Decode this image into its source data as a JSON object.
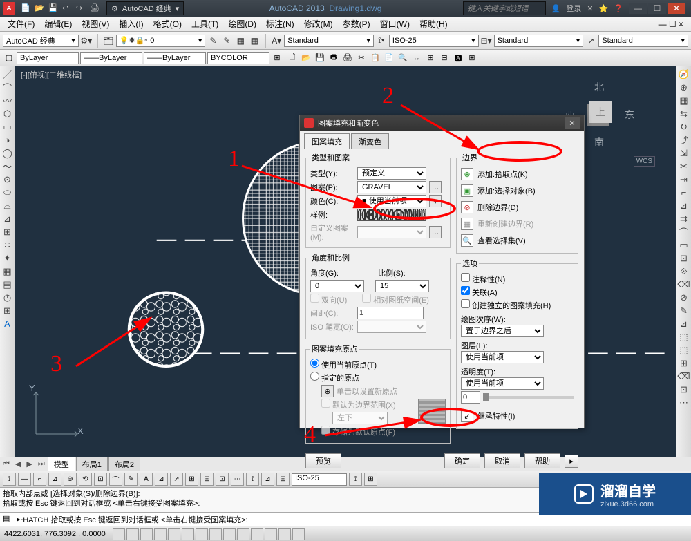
{
  "titlebar": {
    "workspace": "AutoCAD 经典",
    "app": "AutoCAD 2013",
    "file": "Drawing1.dwg",
    "search_ph": "键入关键字或短语",
    "login": "登录"
  },
  "menubar": {
    "file": "文件(F)",
    "edit": "编辑(E)",
    "view": "视图(V)",
    "insert": "插入(I)",
    "format": "格式(O)",
    "tools": "工具(T)",
    "draw": "绘图(D)",
    "dimension": "标注(N)",
    "modify": "修改(M)",
    "parametric": "参数(P)",
    "window": "窗口(W)",
    "help": "帮助(H)"
  },
  "toolbar1": {
    "workspace": "AutoCAD 经典",
    "layer": "0",
    "textstyle": "Standard",
    "dimstyle": "ISO-25",
    "tablestyle": "Standard",
    "mlstyle": "Standard"
  },
  "toolbar2": {
    "bylayer": "ByLayer",
    "bycolor": "BYCOLOR"
  },
  "canvas": {
    "viewlabel": "[-][俯视][二维线框]",
    "north": "北",
    "south": "南",
    "east": "东",
    "west": "西",
    "top": "上",
    "wcs": "WCS",
    "ucs_x": "X",
    "ucs_y": "Y"
  },
  "dialog": {
    "title": "图案填充和渐变色",
    "tab_hatch": "图案填充",
    "tab_grad": "渐变色",
    "fs_type": "类型和图案",
    "lbl_type": "类型(Y):",
    "val_type": "预定义",
    "lbl_pattern": "图案(P):",
    "val_pattern": "GRAVEL",
    "lbl_color": "颜色(C):",
    "val_color": "■ 使用当前项",
    "lbl_sample": "样例:",
    "lbl_custom": "自定义图案(M):",
    "fs_angle": "角度和比例",
    "lbl_angle": "角度(G):",
    "val_angle": "0",
    "lbl_scale": "比例(S):",
    "val_scale": "15",
    "chk_double": "双向(U)",
    "chk_paper": "相对图纸空间(E)",
    "lbl_spacing": "间距(C):",
    "val_spacing": "1",
    "lbl_iso": "ISO 笔宽(O):",
    "fs_origin": "图案填充原点",
    "rad_cur": "使用当前原点(T)",
    "rad_spec": "指定的原点",
    "btn_click": "单击以设置新原点",
    "chk_default": "默认为边界范围(X)",
    "dd_bl": "左下",
    "chk_store": "存储为默认原点(F)",
    "fs_bounds": "边界",
    "b_pick": "添加:拾取点(K)",
    "b_select": "添加:选择对象(B)",
    "b_remove": "删除边界(D)",
    "b_recreate": "重新创建边界(R)",
    "b_viewsel": "查看选择集(V)",
    "fs_options": "选项",
    "chk_annot": "注释性(N)",
    "chk_assoc": "关联(A)",
    "chk_sep": "创建独立的图案填充(H)",
    "lbl_order": "绘图次序(W):",
    "val_order": "置于边界之后",
    "lbl_layer": "图层(L):",
    "val_layer": "使用当前项",
    "lbl_trans": "透明度(T):",
    "val_trans": "使用当前项",
    "b_inherit": "继承特性(I)",
    "btn_preview": "预览",
    "btn_ok": "确定",
    "btn_cancel": "取消",
    "btn_help": "帮助"
  },
  "tabs": {
    "model": "模型",
    "layout1": "布局1",
    "layout2": "布局2"
  },
  "status": {
    "dimstyle": "ISO-25"
  },
  "cmd": {
    "line1": "拾取内部点或 [选择对象(S)/删除边界(B)]:",
    "line2": "拾取或按 Esc 键返回到对话框或 <单击右键接受图案填充>:",
    "cmdline": "HATCH 拾取或按 Esc 键返回到对话框或 <单击右键接受图案填充>:",
    "prompt": "▸_"
  },
  "coord": {
    "text": "4422.6031,  776.3092 , 0.0000"
  },
  "annotations": {
    "n1": "1",
    "n2": "2",
    "n3": "3",
    "n4": "4"
  },
  "brand": {
    "text": "溜溜自学",
    "domain": "zixue.3d66.com"
  }
}
